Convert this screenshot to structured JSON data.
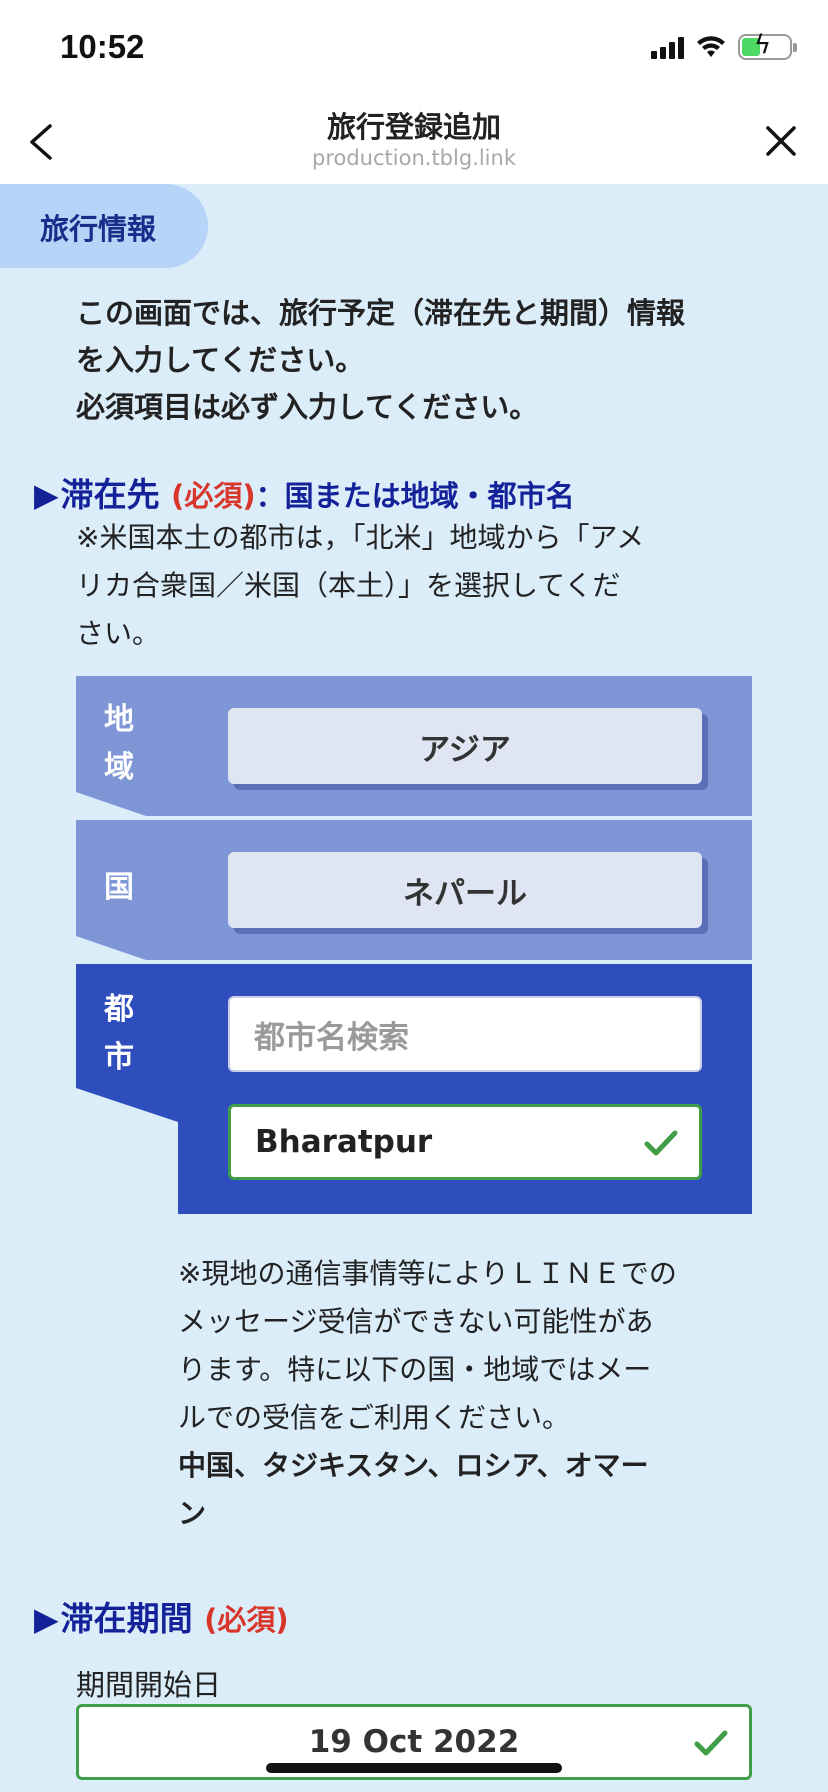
{
  "status_bar": {
    "time": "10:52"
  },
  "header": {
    "title": "旅行登録追加",
    "url": "production.tblg.link"
  },
  "section": {
    "title": "旅行情報"
  },
  "intro": {
    "line1": "この画面では、旅行予定（滞在先と期間）情報",
    "line2": "を入力してください。",
    "line3": "必須項目は必ず入力してください。"
  },
  "destination": {
    "heading": "滞在先",
    "required": "(必須)",
    "subheading": "：国または地域・都市名",
    "note_line1": "※米国本土の都市は，「北米」地域から「アメ",
    "note_line2": "リカ合衆国／米国（本土）」を選択してくだ",
    "note_line3": "さい。",
    "region_label_1": "地",
    "region_label_2": "域",
    "region_value": "アジア",
    "country_label": "国",
    "country_value": "ネパール",
    "city_label_1": "都",
    "city_label_2": "市",
    "city_search_placeholder": "都市名検索",
    "city_value": "Bharatpur",
    "line_note_line1": "※現地の通信事情等によりＬＩＮＥでの",
    "line_note_line2": "メッセージ受信ができない可能性があ",
    "line_note_line3": "ります。特に以下の国・地域ではメー",
    "line_note_line4": "ルでの受信をご利用ください。",
    "line_note_countries_1": "中国、タジキスタン、ロシア、オマー",
    "line_note_countries_2": "ン"
  },
  "period": {
    "heading": "滞在期間",
    "required": "(必須)",
    "start_label": "期間開始日",
    "start_value": "19 Oct 2022"
  },
  "colors": {
    "background": "#dcedfa",
    "accent_navy": "#14229a",
    "required_red": "#d9362b",
    "panel_light": "#7f96d6",
    "panel_dark": "#2e4ebd",
    "valid_green": "#3f9e46"
  }
}
